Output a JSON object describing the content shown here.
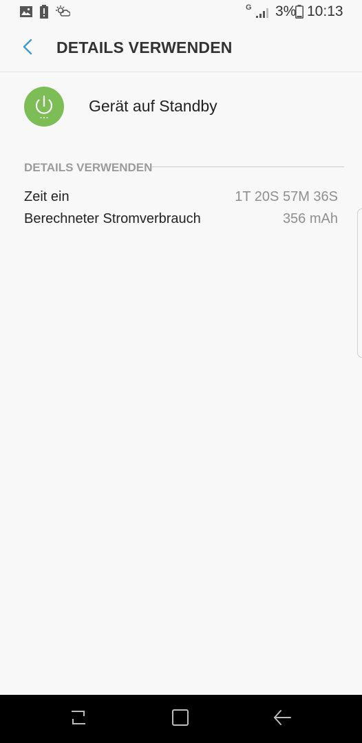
{
  "status_bar": {
    "battery_percent": "3%",
    "time": "10:13",
    "network_letter": "G",
    "left_icons": [
      "gallery-icon",
      "battery-alert-icon",
      "weather-icon"
    ],
    "right_icons": [
      "signal-icon",
      "battery-icon"
    ]
  },
  "app_bar": {
    "title": "DETAILS VERWENDEN",
    "back_icon": "chevron-left-icon"
  },
  "app": {
    "name": "Gerät auf Standby",
    "icon": "power-icon",
    "icon_color": "#7cbd55"
  },
  "section": {
    "header": "DETAILS VERWENDEN"
  },
  "details": [
    {
      "label": "Zeit ein",
      "value": "1T 20S 57M 36S"
    },
    {
      "label": "Berechneter Stromverbrauch",
      "value": "356 mAh"
    }
  ],
  "navigation": {
    "buttons": [
      "recents-icon",
      "home-icon",
      "back-icon"
    ]
  },
  "colors": {
    "background": "#f8f8f8",
    "accent": "#3d9bc9",
    "nav_bar": "#000000"
  }
}
